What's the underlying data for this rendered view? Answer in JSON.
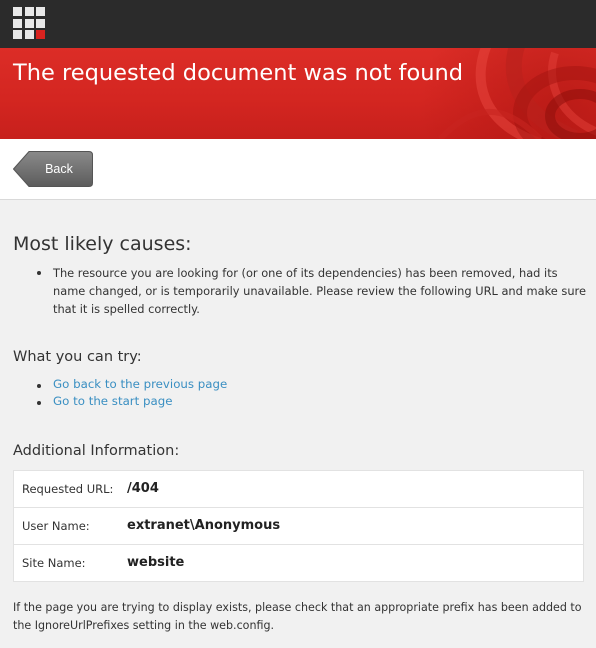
{
  "header": {
    "logo_icon": "sitecore-grid-logo-icon",
    "accent_color": "#d9231f"
  },
  "banner": {
    "title": "The requested document was not found",
    "color": "#d42621"
  },
  "toolbar": {
    "back_label": "Back"
  },
  "causes": {
    "heading": "Most likely causes:",
    "items": [
      "The resource you are looking for (or one of its dependencies) has been removed, had its name changed, or is temporarily unavailable. Please review the following URL and make sure that it is spelled correctly."
    ]
  },
  "try": {
    "heading": "What you can try:",
    "links": [
      "Go back to the previous page",
      "Go to the start page"
    ],
    "link_color": "#3a8fc2"
  },
  "info": {
    "heading": "Additional Information:",
    "rows": [
      {
        "key": "Requested URL:",
        "value": "/404"
      },
      {
        "key": "User Name:",
        "value": "extranet\\Anonymous"
      },
      {
        "key": "Site Name:",
        "value": "website"
      }
    ]
  },
  "footer": {
    "note": "If the page you are trying to display exists, please check that an appropriate prefix has been added to the IgnoreUrlPrefixes setting in the web.config."
  }
}
